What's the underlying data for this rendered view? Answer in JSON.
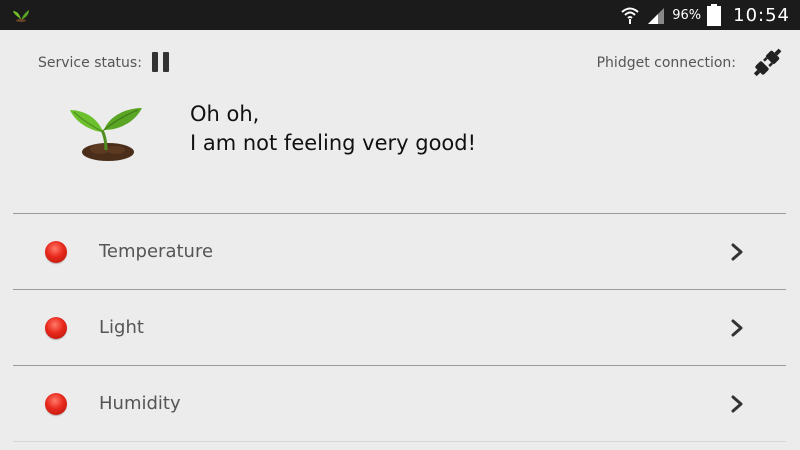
{
  "status_bar": {
    "battery_percent": "96%",
    "time": "10:54",
    "background_color": "#1b1b1b",
    "icons": [
      "app-leaf-icon",
      "wifi-icon",
      "signal-icon",
      "battery-icon"
    ]
  },
  "header": {
    "service_status_label": "Service status:",
    "service_status_icon": "pause-icon",
    "phidget_connection_label": "Phidget connection:",
    "phidget_connection_icon": "plug-disconnected-icon"
  },
  "plant": {
    "icon": "plant-sprout-icon",
    "message_line1": "Oh oh,",
    "message_line2": "I am not feeling very good!"
  },
  "sensors": [
    {
      "label": "Temperature",
      "status_color": "#e8281c",
      "status_icon": "red-status-dot",
      "action_icon": "chevron-right-icon"
    },
    {
      "label": "Light",
      "status_color": "#e8281c",
      "status_icon": "red-status-dot",
      "action_icon": "chevron-right-icon"
    },
    {
      "label": "Humidity",
      "status_color": "#e8281c",
      "status_icon": "red-status-dot",
      "action_icon": "chevron-right-icon"
    }
  ],
  "colors": {
    "background": "#ececec",
    "divider": "#9a9a9a",
    "plant_green": "#5aa624",
    "soil_brown": "#4a2e1a"
  }
}
